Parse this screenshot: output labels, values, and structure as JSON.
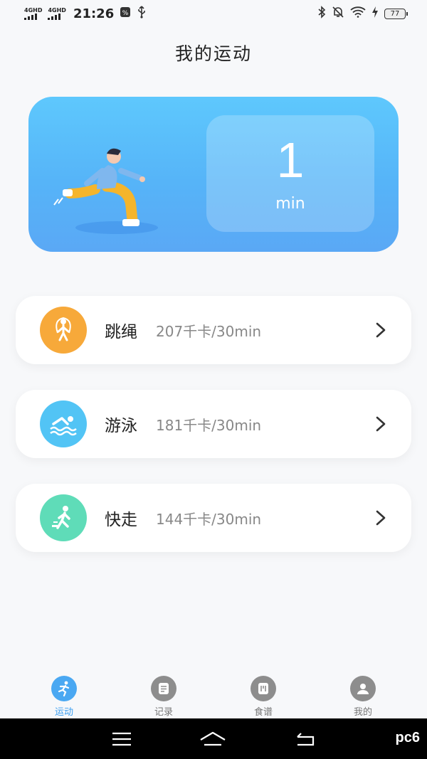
{
  "status": {
    "sim1": "4GHD",
    "sim2": "4GHD",
    "time": "21:26",
    "battery": "77"
  },
  "page_title": "我的运动",
  "hero": {
    "timer_value": "1",
    "timer_unit": "min",
    "gradient": [
      "#5ec8fd",
      "#5aa8f5"
    ]
  },
  "exercises": [
    {
      "name": "跳绳",
      "info": "207千卡/30min",
      "icon": "jump-rope-icon",
      "color": "#f7a93a"
    },
    {
      "name": "游泳",
      "info": "181千卡/30min",
      "icon": "swimming-icon",
      "color": "#52c4f5"
    },
    {
      "name": "快走",
      "info": "144千卡/30min",
      "icon": "walking-icon",
      "color": "#5fdcb8"
    }
  ],
  "tabs": [
    {
      "label": "运动",
      "icon": "running-icon",
      "active": true
    },
    {
      "label": "记录",
      "icon": "record-icon",
      "active": false
    },
    {
      "label": "食谱",
      "icon": "recipe-icon",
      "active": false
    },
    {
      "label": "我的",
      "icon": "user-icon",
      "active": false
    }
  ],
  "watermark": "pc6"
}
